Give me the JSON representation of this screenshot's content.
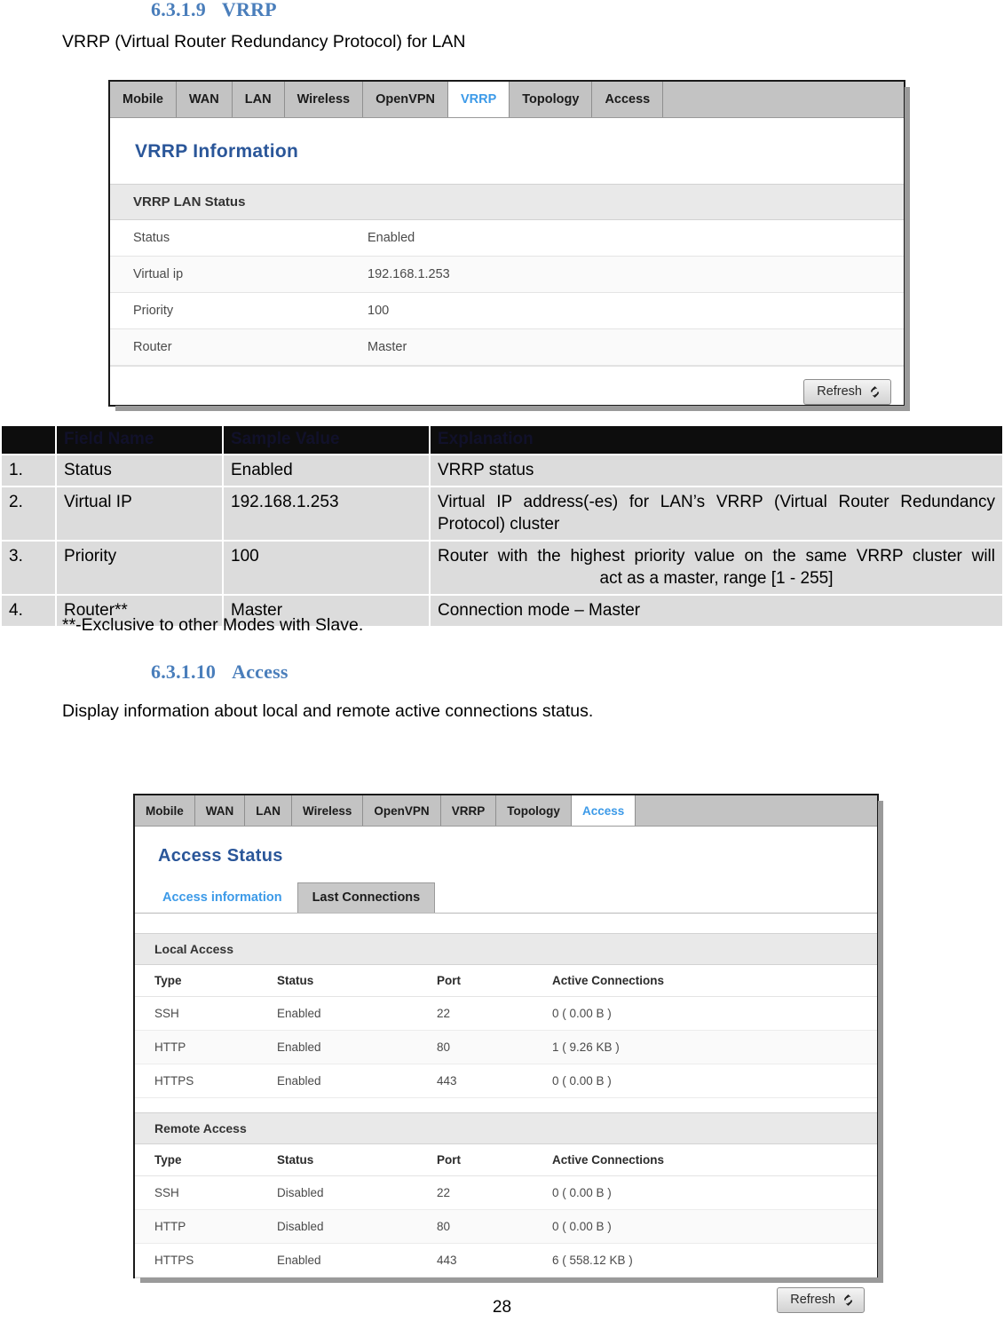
{
  "document": {
    "section_vrrp": {
      "number": "6.3.1.9",
      "title": "VRRP"
    },
    "vrrp_intro": "VRRP (Virtual Router Redundancy Protocol) for LAN",
    "section_access": {
      "number": "6.3.1.10",
      "title": "Access"
    },
    "access_intro": "Display information about local and remote active connections status.",
    "footnote": "**-Exclusive to other Modes with Slave.",
    "page_number": "28"
  },
  "explanation_table": {
    "headers": {
      "index": "",
      "field_name": "Field Name",
      "sample_value": "Sample Value",
      "explanation": "Explanation"
    },
    "rows": [
      {
        "index": "1.",
        "field_name": "Status",
        "sample_value": "Enabled",
        "explanation_line1": "VRRP status",
        "explanation_line2": ""
      },
      {
        "index": "2.",
        "field_name": "Virtual IP",
        "sample_value": "192.168.1.253",
        "explanation_line1": "Virtual IP address(-es) for LAN’s VRRP (Virtual Router Redundancy",
        "explanation_line2": "Protocol) cluster"
      },
      {
        "index": "3.",
        "field_name": "Priority",
        "sample_value": "100",
        "explanation_line1": "Router with the highest priority value on the same VRRP cluster will",
        "explanation_line2": "act as a master, range [1 - 255]"
      },
      {
        "index": "4.",
        "field_name": "Router**",
        "sample_value": "Master",
        "explanation_line1": "Connection mode – Master",
        "explanation_line2": ""
      }
    ]
  },
  "vrrp_panel": {
    "tabs": [
      {
        "label": "Mobile",
        "active": false
      },
      {
        "label": "WAN",
        "active": false
      },
      {
        "label": "LAN",
        "active": false
      },
      {
        "label": "Wireless",
        "active": false
      },
      {
        "label": "OpenVPN",
        "active": false
      },
      {
        "label": "VRRP",
        "active": true
      },
      {
        "label": "Topology",
        "active": false
      },
      {
        "label": "Access",
        "active": false
      }
    ],
    "title": "VRRP Information",
    "section_header": "VRRP LAN Status",
    "rows": [
      {
        "key": "Status",
        "value": "Enabled"
      },
      {
        "key": "Virtual ip",
        "value": "192.168.1.253"
      },
      {
        "key": "Priority",
        "value": "100"
      },
      {
        "key": "Router",
        "value": "Master"
      }
    ],
    "refresh_label": "Refresh"
  },
  "access_panel": {
    "tabs": [
      {
        "label": "Mobile",
        "active": false
      },
      {
        "label": "WAN",
        "active": false
      },
      {
        "label": "LAN",
        "active": false
      },
      {
        "label": "Wireless",
        "active": false
      },
      {
        "label": "OpenVPN",
        "active": false
      },
      {
        "label": "VRRP",
        "active": false
      },
      {
        "label": "Topology",
        "active": false
      },
      {
        "label": "Access",
        "active": true
      }
    ],
    "title": "Access Status",
    "subtabs": [
      {
        "label": "Access information",
        "active": true
      },
      {
        "label": "Last Connections",
        "active": false
      }
    ],
    "local": {
      "section_header": "Local Access",
      "columns": {
        "type": "Type",
        "status": "Status",
        "port": "Port",
        "connections": "Active Connections"
      },
      "rows": [
        {
          "type": "SSH",
          "status": "Enabled",
          "port": "22",
          "connections": "0 ( 0.00 B )"
        },
        {
          "type": "HTTP",
          "status": "Enabled",
          "port": "80",
          "connections": "1 ( 9.26 KB )"
        },
        {
          "type": "HTTPS",
          "status": "Enabled",
          "port": "443",
          "connections": "0 ( 0.00 B )"
        }
      ]
    },
    "remote": {
      "section_header": "Remote Access",
      "columns": {
        "type": "Type",
        "status": "Status",
        "port": "Port",
        "connections": "Active Connections"
      },
      "rows": [
        {
          "type": "SSH",
          "status": "Disabled",
          "port": "22",
          "connections": "0 ( 0.00 B )"
        },
        {
          "type": "HTTP",
          "status": "Disabled",
          "port": "80",
          "connections": "0 ( 0.00 B )"
        },
        {
          "type": "HTTPS",
          "status": "Enabled",
          "port": "443",
          "connections": "6 ( 558.12 KB )"
        }
      ]
    },
    "refresh_label": "Refresh"
  },
  "colors": {
    "heading_blue": "#4a7ebb",
    "panel_title_blue": "#2a5699",
    "active_tab_blue": "#3c9ae8",
    "tab_gray": "#c3c3c3",
    "section_gray": "#e9e9e9",
    "doc_table_header_bg": "#0d0d0d",
    "doc_table_cell_bg": "#dcdcdc"
  }
}
